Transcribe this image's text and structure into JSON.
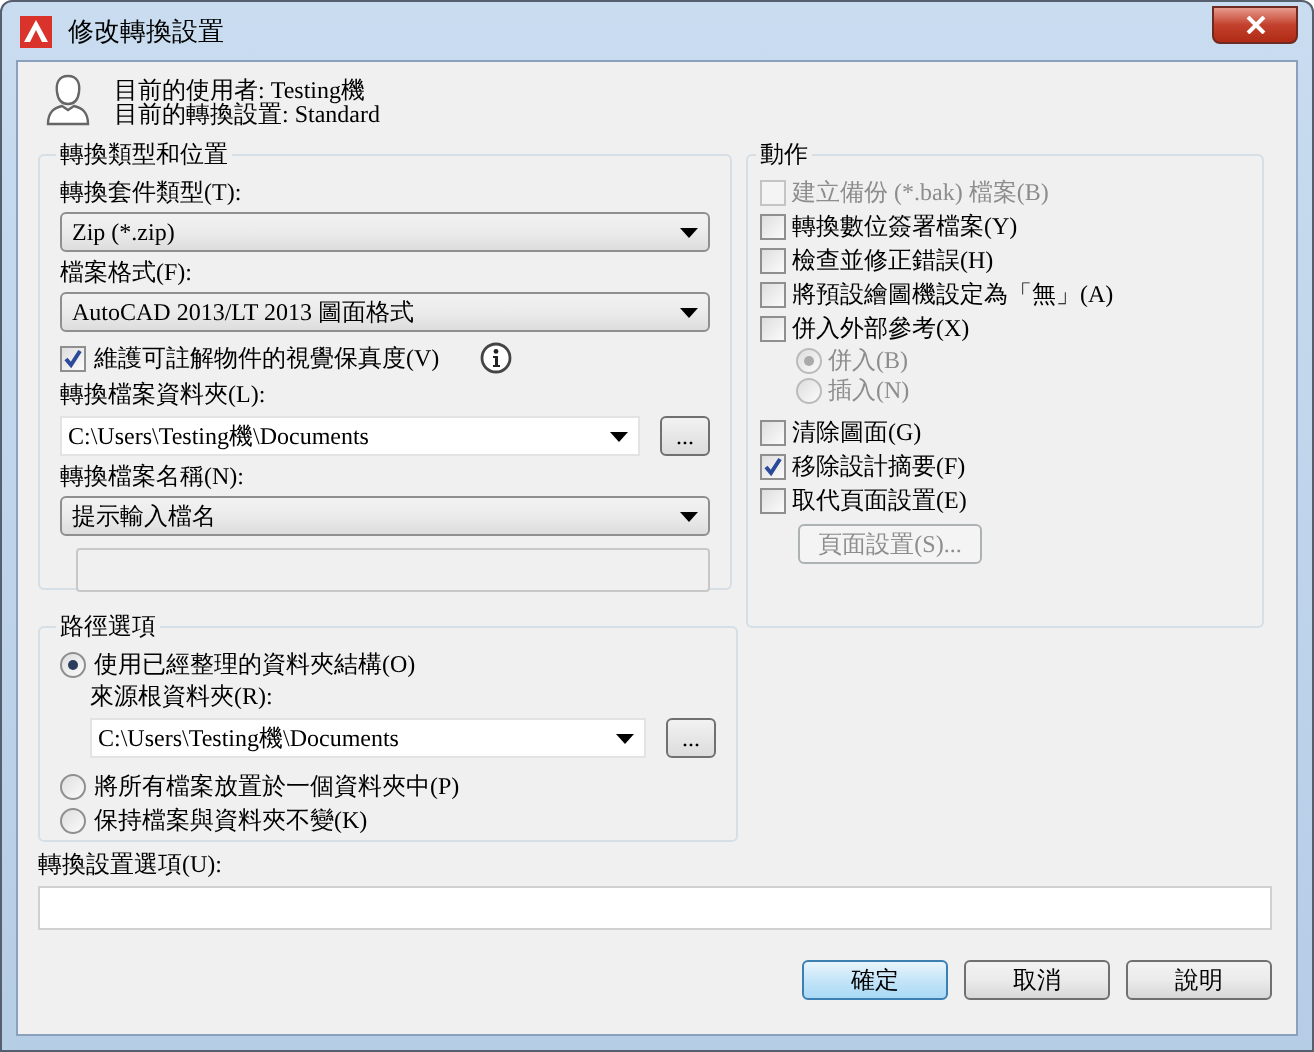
{
  "window": {
    "title": "修改轉換設置"
  },
  "user_info": [
    "目前的使用者: Testing機",
    "目前的轉換設置: Standard"
  ],
  "type_location": {
    "title": "轉換類型和位置",
    "package_type": {
      "label": "轉換套件類型(T):",
      "value": "Zip (*.zip)"
    },
    "file_format": {
      "label": "檔案格式(F):",
      "value": "AutoCAD 2013/LT 2013 圖面格式"
    },
    "maintain_visual": {
      "label": "維護可註解物件的視覺保真度(V)",
      "checked": true
    },
    "folder": {
      "label": "轉換檔案資料夾(L):",
      "value": "C:\\Users\\Testing機\\Documents",
      "browse": "..."
    },
    "file_name": {
      "label": "轉換檔案名稱(N):",
      "value": "提示輸入檔名"
    },
    "name_field": {
      "disabled": true
    }
  },
  "path_options": {
    "title": "路徑選項",
    "options": [
      {
        "label": "使用已經整理的資料夾結構(O)",
        "selected": true
      },
      {
        "label": "將所有檔案放置於一個資料夾中(P)",
        "selected": false
      },
      {
        "label": "保持檔案與資料夾不變(K)",
        "selected": false
      }
    ],
    "source_root": {
      "label": "來源根資料夾(R):",
      "value": "C:\\Users\\Testing機\\Documents",
      "browse": "..."
    }
  },
  "actions": {
    "title": "動作",
    "items": [
      {
        "kind": "checkbox",
        "label": "建立備份 (*.bak) 檔案(B)",
        "checked": false,
        "disabled": true
      },
      {
        "kind": "checkbox",
        "label": "轉換數位簽署檔案(Y)",
        "checked": false,
        "disabled": false
      },
      {
        "kind": "checkbox",
        "label": "檢查並修正錯誤(H)",
        "checked": false,
        "disabled": false
      },
      {
        "kind": "checkbox",
        "label": "將預設繪圖機設定為「無」(A)",
        "checked": false,
        "disabled": false
      },
      {
        "kind": "checkbox",
        "label": "併入外部參考(X)",
        "checked": false,
        "disabled": false
      },
      {
        "kind": "radio",
        "label": "併入(B)",
        "selected": true,
        "disabled": true
      },
      {
        "kind": "radio",
        "label": "插入(N)",
        "selected": false,
        "disabled": true
      },
      {
        "kind": "checkbox",
        "label": "清除圖面(G)",
        "checked": false,
        "disabled": false
      },
      {
        "kind": "checkbox",
        "label": "移除設計摘要(F)",
        "checked": true,
        "disabled": false
      },
      {
        "kind": "checkbox",
        "label": "取代頁面設置(E)",
        "checked": false,
        "disabled": false
      },
      {
        "kind": "button",
        "label": "頁面設置(S)...",
        "disabled": true
      }
    ]
  },
  "options_field": {
    "label": "轉換設置選項(U):"
  },
  "buttons": [
    {
      "label": "確定",
      "default": true
    },
    {
      "label": "取消",
      "default": false
    },
    {
      "label": "說明",
      "default": false
    }
  ]
}
